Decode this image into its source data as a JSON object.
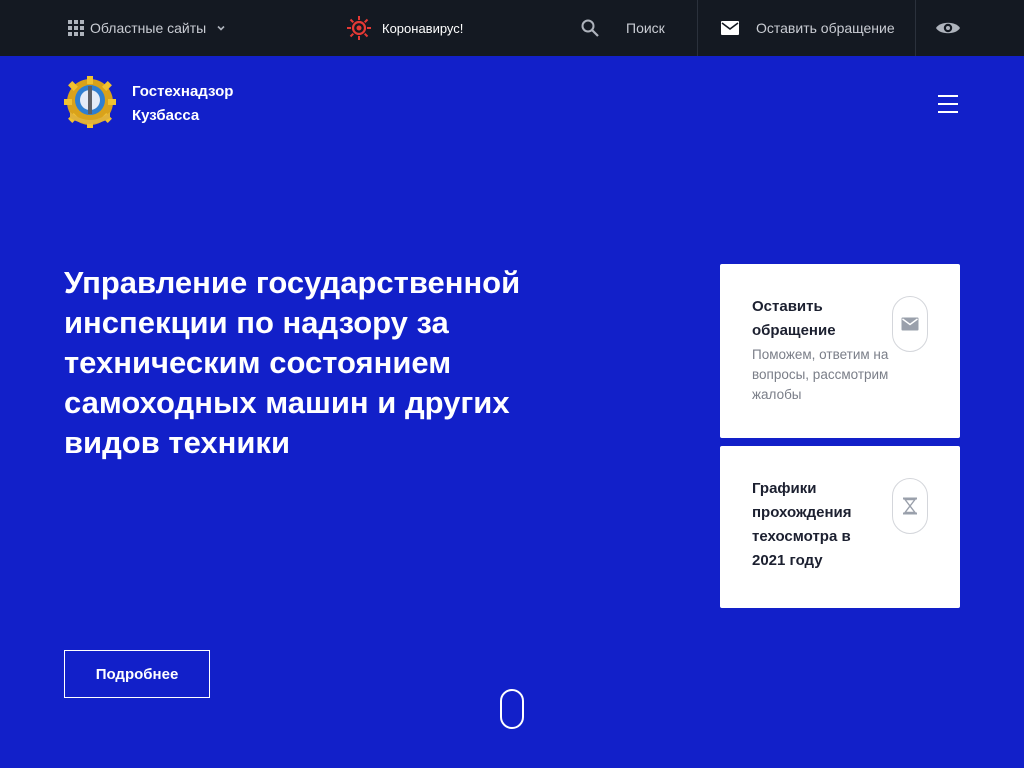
{
  "topbar": {
    "regional_label": "Областные сайты",
    "corona_label": "Коронавирус!",
    "search_label": "Поиск",
    "appeal_label": "Оставить обращение"
  },
  "brand": {
    "line1": "Гостехнадзор",
    "line2": "Кузбасса"
  },
  "hero": {
    "headline": "Управление государственной инспекции по надзору за техническим состоянием самоходных машин и других видов техники",
    "more_label": "Подробнее"
  },
  "cards": [
    {
      "title": "Оставить обращение",
      "description": "Поможем, ответим на вопросы, рассмотрим жалобы",
      "icon": "mail-icon"
    },
    {
      "title": "Графики прохождения техосмотра в 2021 году",
      "icon": "hourglass-icon"
    }
  ],
  "colors": {
    "hero_bg": "#1220c9",
    "topbar_bg": "#141922",
    "corona_accent": "#e53935"
  }
}
